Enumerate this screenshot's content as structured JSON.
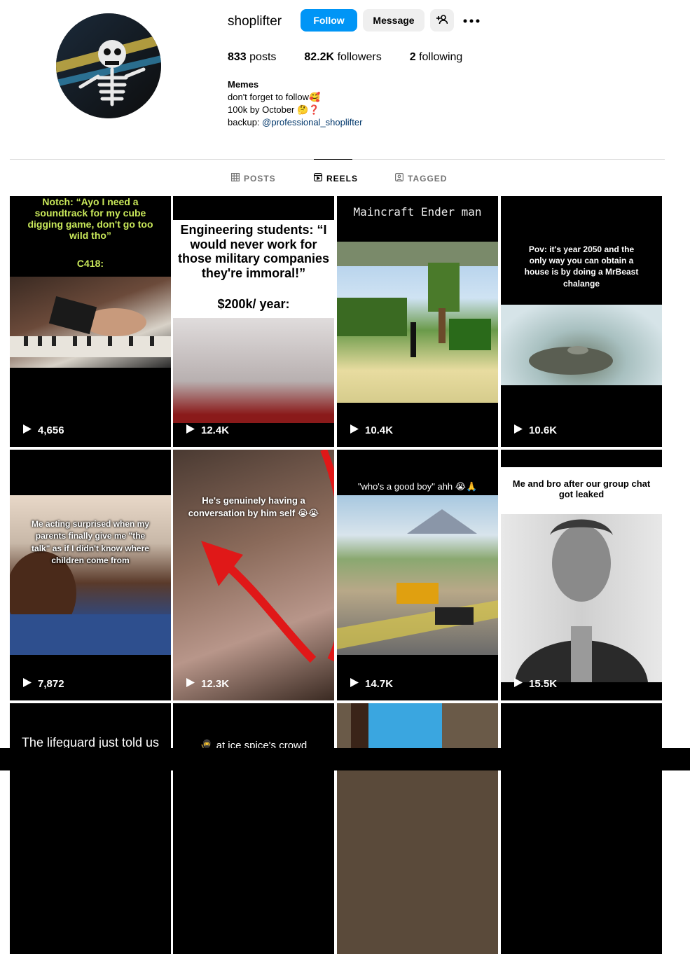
{
  "profile": {
    "username": "shoplifter",
    "follow_label": "Follow",
    "message_label": "Message",
    "posts_count": "833",
    "posts_label": "posts",
    "followers_count": "82.2K",
    "followers_label": "followers",
    "following_count": "2",
    "following_label": "following",
    "bio_name": "Memes",
    "bio_line1": "don't forget to follow🥰",
    "bio_line2": "100k by October 🤔❓",
    "bio_backup_prefix": "backup: ",
    "bio_backup_link": "@professional_shoplifter"
  },
  "tabs": [
    {
      "label": "POSTS",
      "icon": "grid-icon"
    },
    {
      "label": "REELS",
      "icon": "reels-icon",
      "active": true
    },
    {
      "label": "TAGGED",
      "icon": "tagged-icon"
    }
  ],
  "reels": [
    {
      "caption": "Notch: “Ayo I need a soundtrack for my cube digging game, don't go too wild tho”",
      "sub": "C418:",
      "views": "4,656"
    },
    {
      "caption": "Engineering students: “I would never work for those military companies they're immoral!”",
      "sub": "$200k/ year:",
      "views": "12.4K"
    },
    {
      "caption": "Maincraft Ender man",
      "views": "10.4K"
    },
    {
      "caption": "Pov: it's year 2050 and the only way you can obtain a house is by doing a MrBeast chalange",
      "views": "10.6K"
    },
    {
      "caption": "Me acting surprised when my parents finally give me \"the talk\" as if I didn't know where children come from",
      "views": "7,872"
    },
    {
      "caption": "He's genuinely having a conversation by him self 😭😭",
      "views": "12.3K"
    },
    {
      "caption": "\"who's a good boy\" ahh 😭🙏",
      "views": "14.7K"
    },
    {
      "caption": "Me and bro after our group chat got leaked",
      "views": "15.5K"
    },
    {
      "caption": "The lifeguard just told us"
    },
    {
      "caption": "🥷 at ice spice's crowd"
    }
  ],
  "colors": {
    "accent": "#0095f6",
    "link": "#00376b",
    "button_gray": "#efefef",
    "tab_inactive": "#737373"
  }
}
